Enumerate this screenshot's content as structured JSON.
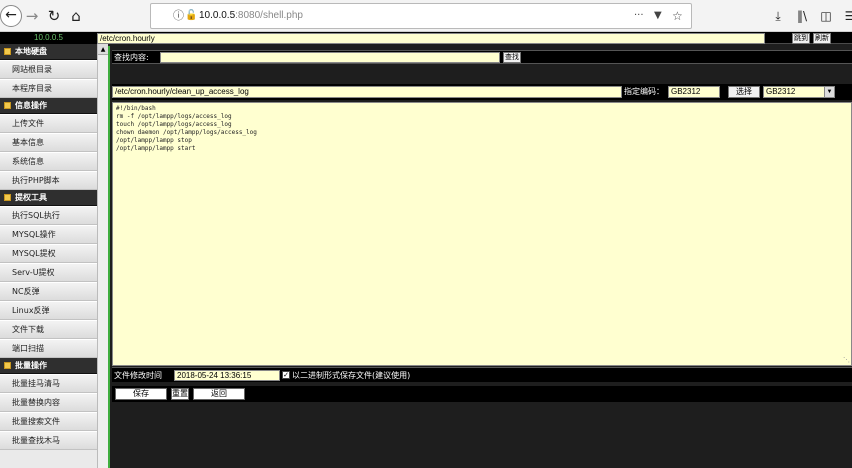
{
  "browser": {
    "host": "10.0.0.5",
    "port_path": ":8080/shell.php",
    "url_more": "···"
  },
  "left": {
    "host_label": "10.0.0.5",
    "sections": [
      {
        "title": "本地硬盘",
        "items": [
          "网站根目录",
          "本程序目录"
        ]
      },
      {
        "title": "信息操作",
        "items": [
          "上传文件",
          "基本信息",
          "系统信息",
          "执行PHP脚本"
        ]
      },
      {
        "title": "提权工具",
        "items": [
          "执行SQL执行",
          "MYSQL操作",
          "MYSQL提权",
          "Serv-U提权",
          "NC反弹",
          "Linux反弹",
          "文件下载",
          "端口扫描"
        ]
      },
      {
        "title": "批量操作",
        "items": [
          "批量挂马清马",
          "批量替换内容",
          "批量搜索文件",
          "批量查找木马"
        ]
      }
    ]
  },
  "pathbar": {
    "path": "/etc/cron.hourly",
    "jump_label": "跳到",
    "refresh_label": "刷新"
  },
  "search": {
    "label": "查找内容:",
    "value": "",
    "button": "查找"
  },
  "file": {
    "path": "/etc/cron.hourly/clean_up_access_log",
    "encoding_label": "指定编码：",
    "encoding_value": "GB2312",
    "choose_label": "选择",
    "encoding_select": "GB2312"
  },
  "editor": {
    "content": "#!/bin/bash\nrm -f /opt/lampp/logs/access_log\ntouch /opt/lampp/logs/access_log\nchown daemon /opt/lampp/logs/access_log\n/opt/lampp/lampp stop\n/opt/lampp/lampp start"
  },
  "modtime": {
    "label": "文件修改时间",
    "value": "2018-05-24 13:36:15",
    "binary_label": "以二进制形式保存文件(建议使用)"
  },
  "actions": {
    "save": "保存",
    "reset": "重置",
    "back": "返回"
  }
}
